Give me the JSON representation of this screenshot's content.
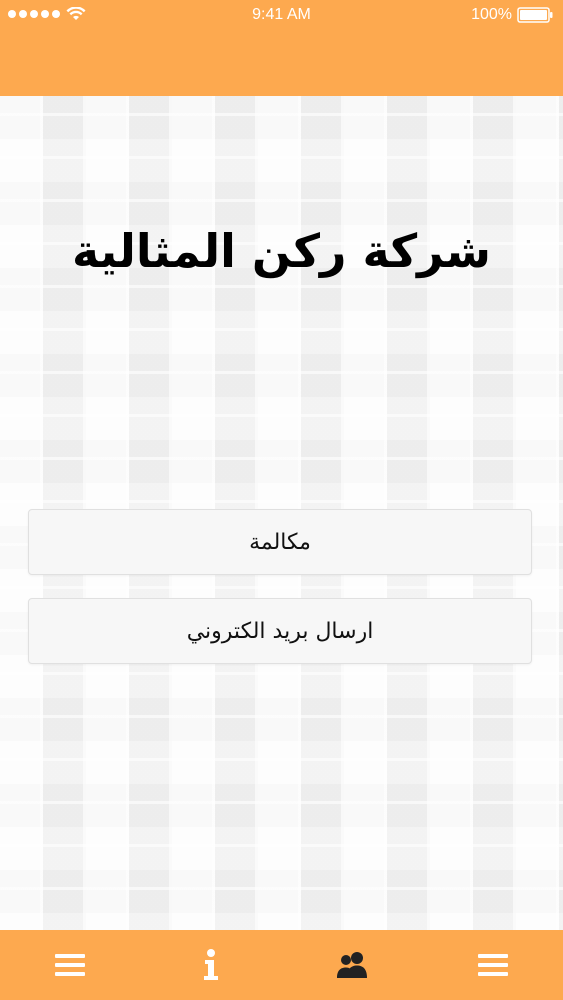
{
  "status_bar": {
    "time": "9:41 AM",
    "battery": "100%",
    "icons": [
      "signal-dots-icon",
      "wifi-icon",
      "battery-icon"
    ]
  },
  "colors": {
    "accent": "#fda94f",
    "icon_white": "#ffffff",
    "icon_dark": "#222222"
  },
  "main": {
    "title": "شركة ركن المثالية",
    "buttons": {
      "call": "مكالمة",
      "email": "ارسال بريد الكتروني"
    }
  },
  "tab_bar": {
    "tabs": [
      {
        "icon": "menu-icon",
        "active": false
      },
      {
        "icon": "info-icon",
        "active": false
      },
      {
        "icon": "users-icon",
        "active": true
      },
      {
        "icon": "menu-icon",
        "active": false
      }
    ]
  }
}
